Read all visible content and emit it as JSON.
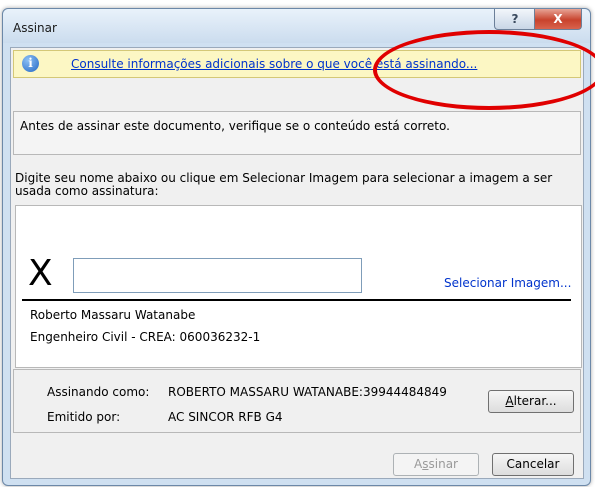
{
  "window": {
    "title": "Assinar",
    "help_label": "?",
    "close_label": "X"
  },
  "info": {
    "link_text": "Consulte informações adicionais sobre o que você está assinando..."
  },
  "verify": {
    "text": "Antes de assinar este documento, verifique se o conteúdo está correto."
  },
  "instruction": {
    "line1": "Digite seu nome abaixo ou clique em Selecionar Imagem para selecionar a imagem a ser",
    "line2": "usada como assinatura:"
  },
  "signature": {
    "x_mark": "X",
    "name_value": "",
    "select_image_label": "Selecionar Imagem...",
    "signer_name": "Roberto Massaru Watanabe",
    "signer_title": "Engenheiro Civil - CREA: 060036232-1"
  },
  "certificate": {
    "signing_as_label": "Assinando como:",
    "signing_as_value": "ROBERTO MASSARU WATANABE:39944484849",
    "issued_by_label": "Emitido por:",
    "issued_by_value": "AC SINCOR RFB G4",
    "change_prefix": "A",
    "change_rest": "lterar..."
  },
  "buttons": {
    "sign_prefix": "A",
    "sign_mid": "s",
    "sign_rest": "sinar",
    "cancel_label": "Cancelar"
  },
  "annotation": {
    "ellipse_color": "#e00000"
  }
}
